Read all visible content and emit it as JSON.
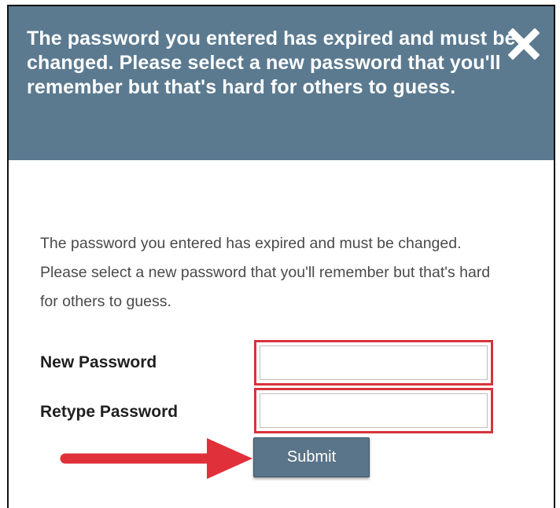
{
  "dialog": {
    "banner_text": "The password you entered has expired and must be changed. Please select a new password that you'll remember but that's hard for others to guess.",
    "message_text": "The password you entered has expired and must be changed. Please select a new password that you'll remember but that's hard for others to guess.",
    "close_icon": "close-x-icon",
    "banner_color": "#5b7a90"
  },
  "form": {
    "new_password_label": "New Password",
    "new_password_value": "",
    "retype_password_label": "Retype Password",
    "retype_password_value": "",
    "submit_label": "Submit",
    "submit_color": "#5a7489"
  },
  "annotations": {
    "highlight_color": "#d7333b",
    "arrow_icon": "right-arrow-icon"
  }
}
